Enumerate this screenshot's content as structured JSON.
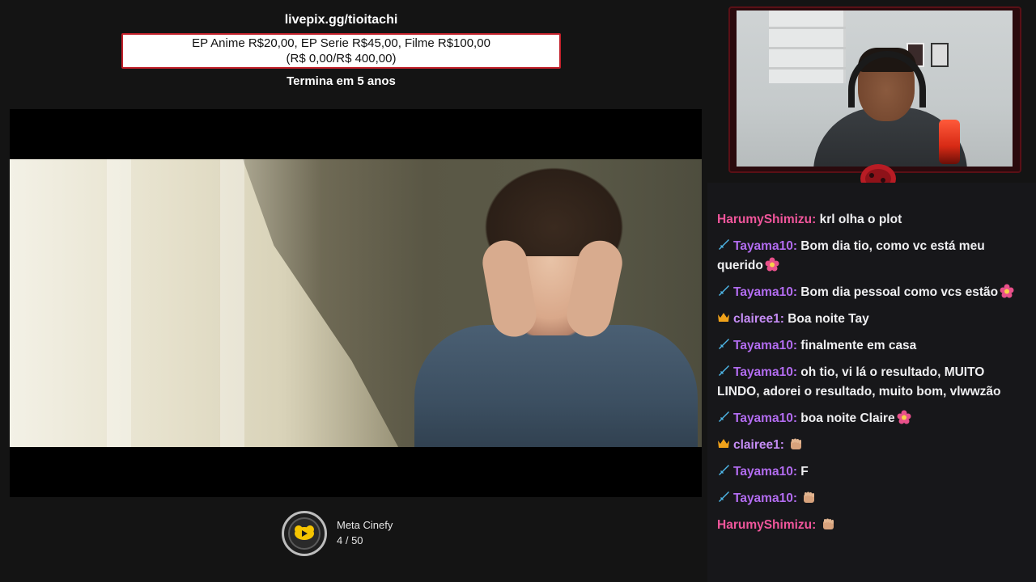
{
  "goal": {
    "url": "livepix.gg/tioitachi",
    "prices": "EP Anime R$20,00, EP Serie R$45,00, Filme R$100,00",
    "progress": "(R$ 0,00/R$ 400,00)",
    "progress_value": 0,
    "progress_target": 400,
    "ends": "Termina em 5 anos"
  },
  "meta": {
    "title": "Meta Cinefy",
    "count": "4 / 50",
    "current": 4,
    "target": 50,
    "icon": "meta-cinefy-icon"
  },
  "chat": {
    "messages": [
      {
        "user": "HarumyShimizu:",
        "text": "krl olha o plot",
        "user_color": "#f0569b",
        "badge": null,
        "emote": null
      },
      {
        "user": "Tayama10:",
        "text": "Bom dia tio, como vc está meu querido",
        "user_color": "#b26cf0",
        "badge": "sword-icon",
        "emote": "flower-emote"
      },
      {
        "user": "Tayama10:",
        "text": "Bom dia pessoal como vcs estão",
        "user_color": "#b26cf0",
        "badge": "sword-icon",
        "emote": "flower-emote"
      },
      {
        "user": "clairee1:",
        "text": "Boa noite Tay",
        "user_color": "#c58cf5",
        "badge": "crown-icon",
        "emote": null
      },
      {
        "user": "Tayama10:",
        "text": "finalmente em casa",
        "user_color": "#b26cf0",
        "badge": "sword-icon",
        "emote": null
      },
      {
        "user": "Tayama10:",
        "text": "oh tio, vi lá o resultado, MUITO LINDO, adorei o resultado, muito bom, vlwwzão",
        "user_color": "#b26cf0",
        "badge": "sword-icon",
        "emote": null
      },
      {
        "user": "Tayama10:",
        "text": "boa noite Claire",
        "user_color": "#b26cf0",
        "badge": "sword-icon",
        "emote": "flower-emote"
      },
      {
        "user": "clairee1:",
        "text": "",
        "user_color": "#c58cf5",
        "badge": "crown-icon",
        "emote": "fist-emote"
      },
      {
        "user": "Tayama10:",
        "text": "F",
        "user_color": "#b26cf0",
        "badge": "sword-icon",
        "emote": null
      },
      {
        "user": "Tayama10:",
        "text": "",
        "user_color": "#b26cf0",
        "badge": "sword-icon",
        "emote": "fist-emote"
      },
      {
        "user": "HarumyShimizu:",
        "text": "",
        "user_color": "#f0569b",
        "badge": null,
        "emote": "fist-emote"
      }
    ]
  },
  "colors": {
    "background": "#141414",
    "goal_border": "#c2202a",
    "chat_bg": "#17171a",
    "frame_red": "#5a1016"
  }
}
